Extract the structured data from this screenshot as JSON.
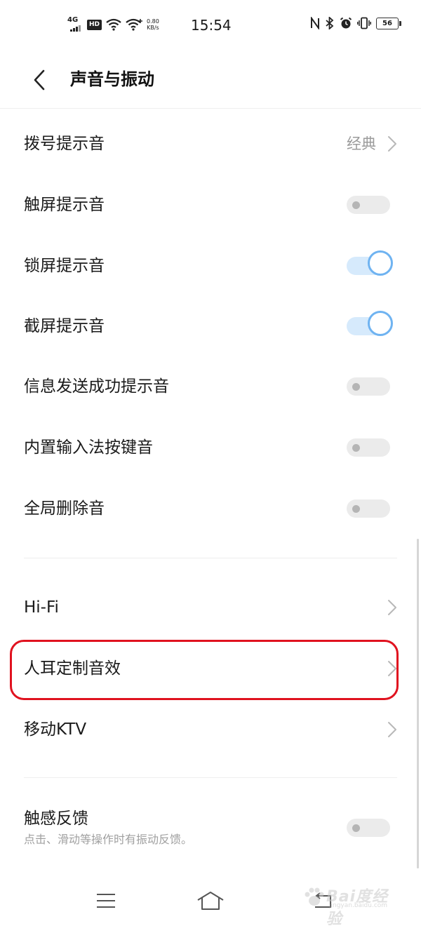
{
  "status_bar": {
    "network_type": "4G",
    "hd_badge": "HD",
    "speed_value": "0.80",
    "speed_unit": "KB/s",
    "time": "15:54",
    "battery_level": "56"
  },
  "header": {
    "title": "声音与振动"
  },
  "sections": {
    "tones": [
      {
        "label": "拨号提示音",
        "value": "经典",
        "control": "chevron"
      },
      {
        "label": "触屏提示音",
        "control": "toggle",
        "on": false
      },
      {
        "label": "锁屏提示音",
        "control": "toggle",
        "on": true
      },
      {
        "label": "截屏提示音",
        "control": "toggle",
        "on": true
      },
      {
        "label": "信息发送成功提示音",
        "control": "toggle",
        "on": false
      },
      {
        "label": "内置输入法按键音",
        "control": "toggle",
        "on": false
      },
      {
        "label": "全局删除音",
        "control": "toggle",
        "on": false
      }
    ],
    "audio": [
      {
        "label": "Hi-Fi",
        "control": "chevron"
      },
      {
        "label": "人耳定制音效",
        "control": "chevron",
        "highlighted": true
      },
      {
        "label": "移动KTV",
        "control": "chevron"
      }
    ],
    "haptic": {
      "label": "触感反馈",
      "subtitle": "点击、滑动等操作时有振动反馈。",
      "on": false
    }
  },
  "nav_bar": {
    "icons": [
      "menu-icon",
      "home-icon",
      "back-icon"
    ]
  },
  "watermark": {
    "brand": "Bai度经验",
    "url": "jingyan.baidu.com"
  },
  "colors": {
    "toggle_on_track": "#d6eafc",
    "toggle_on_ring": "#6fb3f1",
    "toggle_off_track": "#ebebeb",
    "highlight": "#e0121f",
    "secondary_text": "#9b9b9b"
  }
}
